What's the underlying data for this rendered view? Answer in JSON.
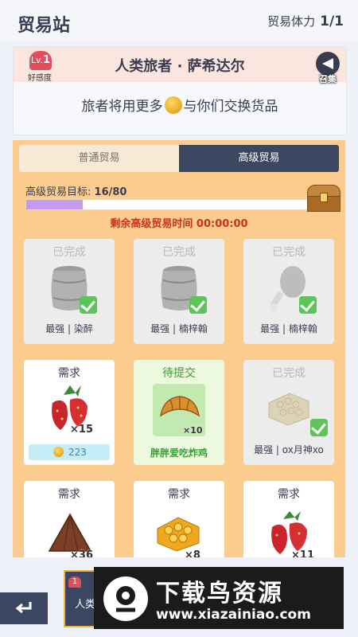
{
  "header": {
    "title": "贸易站",
    "stamina_label": "贸易体力",
    "stamina_value": "1/1"
  },
  "traveler": {
    "level_prefix": "Lv.",
    "level": "1",
    "favor_label": "好感度",
    "name": "人类旅者 · 萨希达尔",
    "summon_label": "召集",
    "message_before": "旅者将用更多",
    "message_after": "与你们交换货品"
  },
  "tabs": {
    "normal": "普通贸易",
    "advanced": "高级贸易"
  },
  "goal": {
    "label": "高级贸易目标:",
    "value": "16/80",
    "progress_fraction": 0.2
  },
  "timer": "剩余高级贸易时间 00:00:00",
  "cards": [
    {
      "status": "已完成",
      "item": "barrel",
      "who": "最强 | 染醉"
    },
    {
      "status": "已完成",
      "item": "barrel",
      "who": "最强 | 楠梓翰"
    },
    {
      "status": "已完成",
      "item": "drumstick",
      "who": "最强 | 楠梓翰"
    },
    {
      "status": "需求",
      "item": "strawberry",
      "qty": "×15",
      "price": "223"
    },
    {
      "status": "待提交",
      "item": "croissant",
      "qty": "×10",
      "who": "胖胖爱吃炸鸡"
    },
    {
      "status": "已完成",
      "item": "honeycomb",
      "who": "最强 | ox月神xo"
    },
    {
      "status": "需求",
      "item": "chocolate",
      "qty": "×36"
    },
    {
      "status": "需求",
      "item": "honeycomb",
      "qty": "×8"
    },
    {
      "status": "需求",
      "item": "strawberry",
      "qty": "×11"
    }
  ],
  "bottom": {
    "mini_heart": "1",
    "mini_text": "人类"
  },
  "watermark": {
    "title": "下载鸟资源",
    "url": "www.xiazainiao.com"
  },
  "colors": {
    "tab_active": "#3b4760",
    "panel": "#fbcc8e",
    "timer": "#c8321e",
    "progress": "#c49bf0",
    "heart": "#e44d5a"
  }
}
